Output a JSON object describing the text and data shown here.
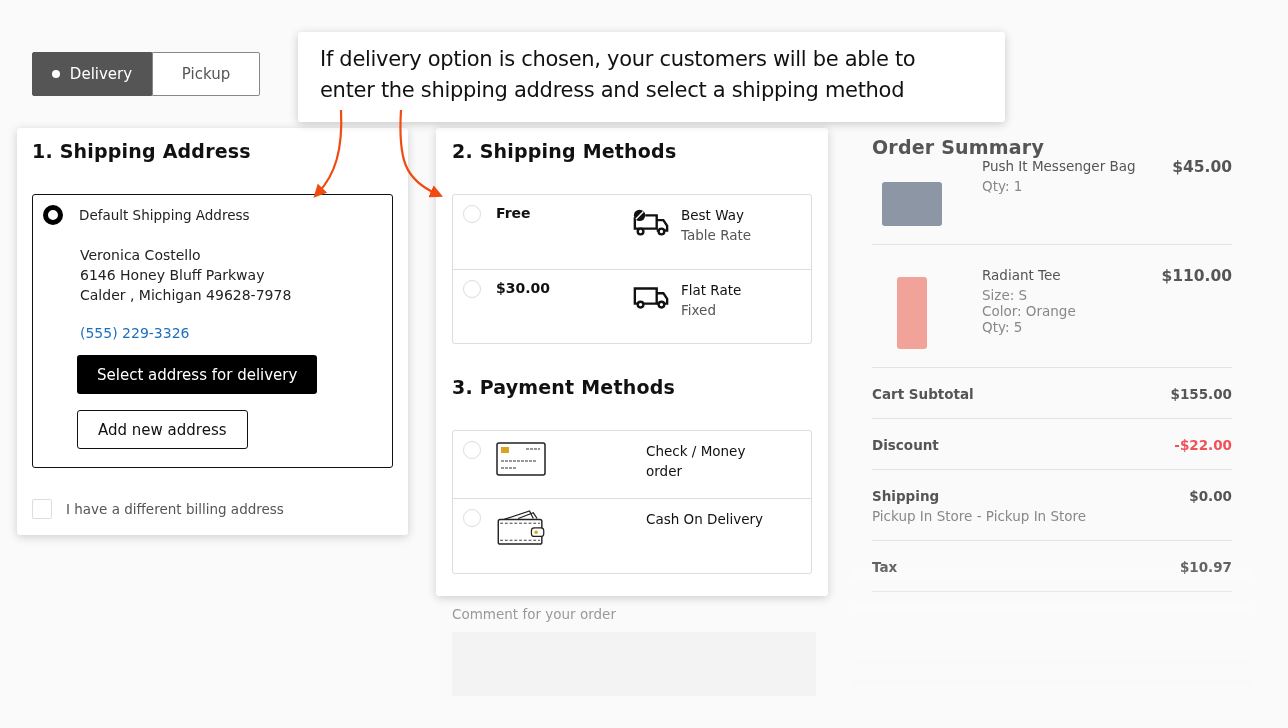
{
  "delivery_tabs": [
    {
      "label": "Delivery",
      "selected": true
    },
    {
      "label": "Pickup",
      "selected": false
    }
  ],
  "callout": {
    "lines": [
      "If delivery option is chosen, your customers will be able to",
      "enter the shipping address and select a shipping method"
    ]
  },
  "shipping_address": {
    "title": "1. Shipping Address",
    "addresses": [
      {
        "label": "Default Shipping Address",
        "selected": true,
        "lines": [
          "Veronica Costello",
          "6146 Honey Bluff Parkway",
          "Calder , Michigan 49628-7978"
        ],
        "phone": "(555) 229-3326",
        "primary_button": "Select address for delivery",
        "secondary_button": "Add new address"
      }
    ],
    "billing": {
      "label": "I have a different billing address",
      "checked": false
    }
  },
  "shipping_methods": {
    "title": "2. Shipping Methods",
    "options": [
      {
        "kind": "table_rate",
        "price": "Free",
        "carrier": "Best Way",
        "method": "Table Rate",
        "selected": false
      },
      {
        "kind": "flat_rate",
        "price": "$30.00",
        "carrier": "Flat Rate",
        "method": "Fixed",
        "selected": false
      }
    ]
  },
  "payment_methods": {
    "title": "3. Payment Methods",
    "options": [
      {
        "kind": "card",
        "label": "Check / Money order",
        "selected": false
      },
      {
        "kind": "cash",
        "label": "Cash On Delivery",
        "selected": false
      }
    ]
  },
  "comment": {
    "label": "Comment for your order"
  },
  "order_summary": {
    "title": "Order Summary",
    "items": [
      {
        "kind": "bag",
        "name": "Push It Messenger Bag",
        "details": [
          "Qty: 1"
        ],
        "price": "$45.00"
      },
      {
        "kind": "tee",
        "name": "Radiant Tee",
        "details": [
          "Size: S",
          "Color: Orange",
          "Qty: 5"
        ],
        "price": "$110.00"
      }
    ],
    "totals": [
      {
        "kind": "amount",
        "label": "Cart Subtotal",
        "value": "$155.00"
      },
      {
        "kind": "discount",
        "label": "Discount",
        "value": "-$22.00"
      },
      {
        "kind": "amount",
        "label": "Shipping",
        "sublabel": "Pickup In Store - Pickup In Store",
        "value": "$0.00"
      },
      {
        "kind": "amount",
        "label": "Tax",
        "value": "$10.97"
      }
    ]
  }
}
